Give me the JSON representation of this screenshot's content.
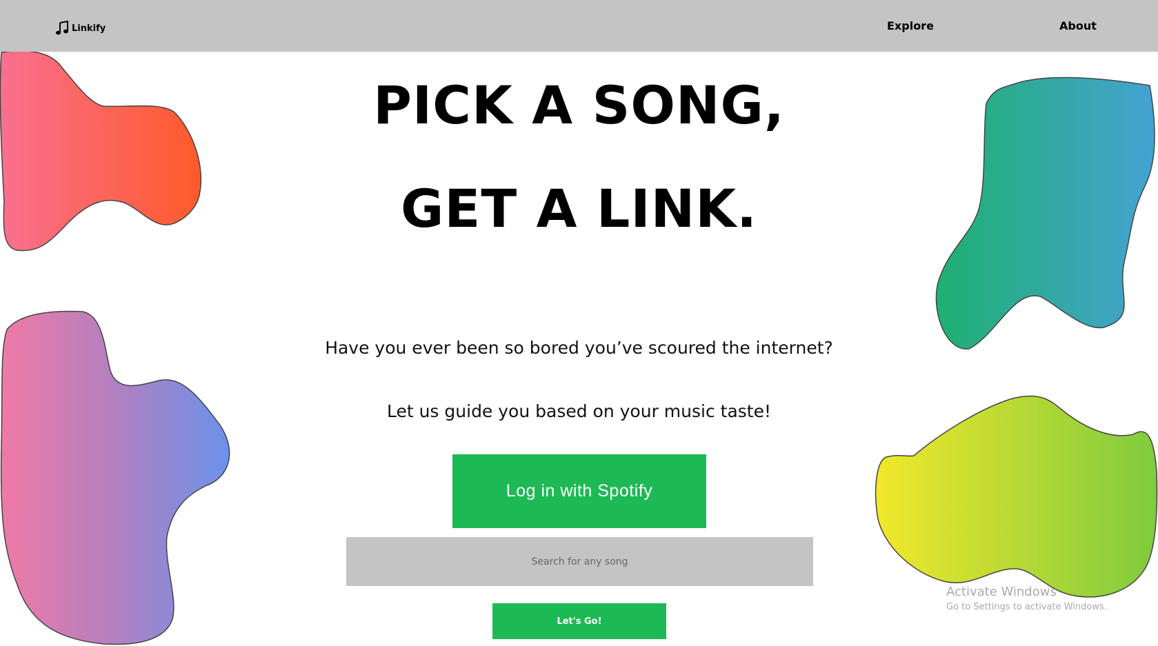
{
  "nav": {
    "brand": "Linkify",
    "explore": "Explore",
    "about": "About"
  },
  "hero": {
    "line1": "PICK A SONG,",
    "line2": "GET A LINK.",
    "subtitle1": "Have you ever been so bored you’ve scoured the internet?",
    "subtitle2": "Let us guide you based on your music taste!"
  },
  "actions": {
    "spotify_label": "Log in with Spotify",
    "search_placeholder": "Search for any song",
    "go_label": "Let's Go!"
  },
  "watermark": {
    "title": "Activate Windows",
    "subtitle": "Go to Settings to activate Windows."
  },
  "colors": {
    "topbar": "#c4c4c4",
    "spotify_green": "#1db954",
    "search_bg": "#c4c4c4"
  },
  "icons": {
    "logo": "music-note-icon"
  }
}
